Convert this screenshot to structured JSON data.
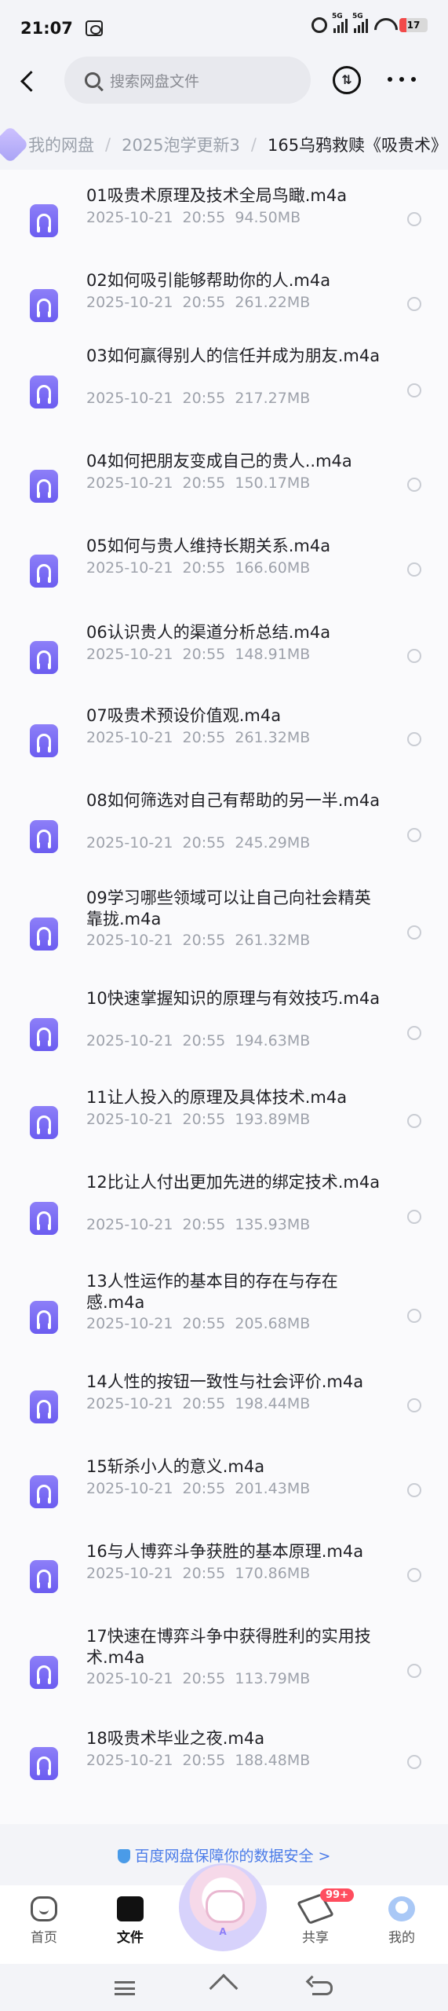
{
  "status_bar": {
    "time": "21:07",
    "signal_1": "5G",
    "signal_2": "5G",
    "battery": "17"
  },
  "top_bar": {
    "search_placeholder": "搜索网盘文件"
  },
  "breadcrumb": {
    "items": [
      "我的网盘",
      "2025泡学更新3"
    ],
    "current": "165乌鸦救赎《吸贵术》"
  },
  "files": [
    {
      "name": "01吸贵术原理及技术全局鸟瞰.m4a",
      "date": "2025-10-21",
      "time": "20:55",
      "size": "94.50MB",
      "icon": "headphones-icon"
    },
    {
      "name": "02如何吸引能够帮助你的人.m4a",
      "date": "2025-10-21",
      "time": "20:55",
      "size": "261.22MB",
      "icon": "headphones-icon"
    },
    {
      "name": "03如何赢得别人的信任并成为朋友.m4a",
      "date": "2025-10-21",
      "time": "20:55",
      "size": "217.27MB",
      "icon": "headphones-icon"
    },
    {
      "name": "04如何把朋友变成自己的贵人..m4a",
      "date": "2025-10-21",
      "time": "20:55",
      "size": "150.17MB",
      "icon": "headphones-icon"
    },
    {
      "name": "05如何与贵人维持长期关系.m4a",
      "date": "2025-10-21",
      "time": "20:55",
      "size": "166.60MB",
      "icon": "headphones-icon"
    },
    {
      "name": "06认识贵人的渠道分析总结.m4a",
      "date": "2025-10-21",
      "time": "20:55",
      "size": "148.91MB",
      "icon": "headphones-icon"
    },
    {
      "name": "07吸贵术预设价值观.m4a",
      "date": "2025-10-21",
      "time": "20:55",
      "size": "261.32MB",
      "icon": "headphones-icon"
    },
    {
      "name": "08如何筛选对自己有帮助的另一半.m4a",
      "date": "2025-10-21",
      "time": "20:55",
      "size": "245.29MB",
      "icon": "headphones-icon"
    },
    {
      "name": "09学习哪些领域可以让自己向社会精英靠拢.m4a",
      "date": "2025-10-21",
      "time": "20:55",
      "size": "261.32MB",
      "icon": "headphones-icon"
    },
    {
      "name": "10快速掌握知识的原理与有效技巧.m4a",
      "date": "2025-10-21",
      "time": "20:55",
      "size": "194.63MB",
      "icon": "headphones-icon"
    },
    {
      "name": "11让人投入的原理及具体技术.m4a",
      "date": "2025-10-21",
      "time": "20:55",
      "size": "193.89MB",
      "icon": "headphones-icon"
    },
    {
      "name": "12比让人付出更加先进的绑定技术.m4a",
      "date": "2025-10-21",
      "time": "20:55",
      "size": "135.93MB",
      "icon": "headphones-icon"
    },
    {
      "name": "13人性运作的基本目的存在与存在感.m4a",
      "date": "2025-10-21",
      "time": "20:55",
      "size": "205.68MB",
      "icon": "headphones-icon"
    },
    {
      "name": "14人性的按钮一致性与社会评价.m4a",
      "date": "2025-10-21",
      "time": "20:55",
      "size": "198.44MB",
      "icon": "headphones-icon"
    },
    {
      "name": "15斩杀小人的意义.m4a",
      "date": "2025-10-21",
      "time": "20:55",
      "size": "201.43MB",
      "icon": "headphones-icon"
    },
    {
      "name": "16与人博弈斗争获胜的基本原理.m4a",
      "date": "2025-10-21",
      "time": "20:55",
      "size": "170.86MB",
      "icon": "headphones-icon"
    },
    {
      "name": "17快速在博弈斗争中获得胜利的实用技术.m4a",
      "date": "2025-10-21",
      "time": "20:55",
      "size": "113.79MB",
      "icon": "headphones-icon"
    },
    {
      "name": "18吸贵术毕业之夜.m4a",
      "date": "2025-10-21",
      "time": "20:55",
      "size": "188.48MB",
      "icon": "headphones-icon"
    }
  ],
  "security_notice": "百度网盘保障你的数据安全 >",
  "tabbar": {
    "home": "首页",
    "files": "文件",
    "share": "共享",
    "share_badge": "99+",
    "mine": "我的"
  }
}
